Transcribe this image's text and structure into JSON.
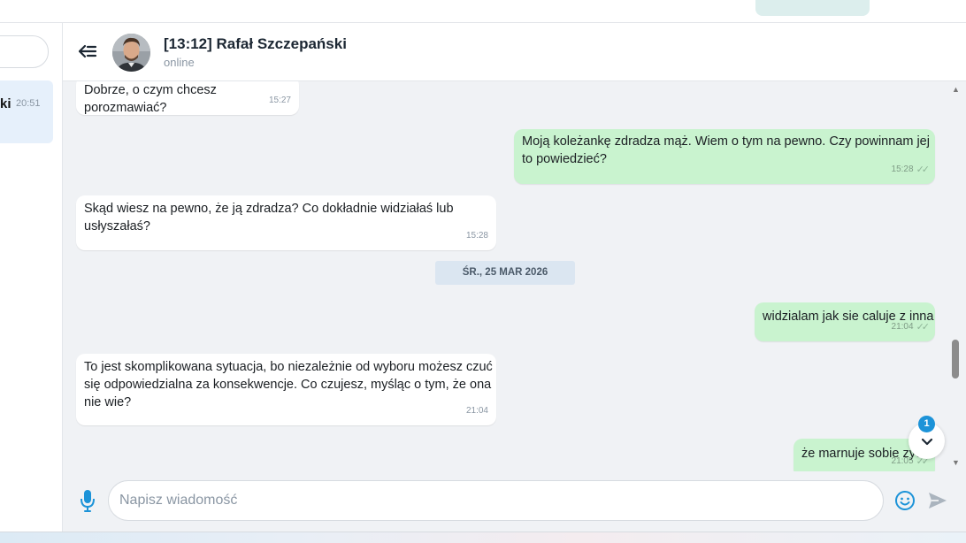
{
  "top": {
    "ghost_text": "p                                                (                                   )  "
  },
  "sidebar": {
    "chat_item": {
      "name_fragment": "ki",
      "time": "20:51"
    }
  },
  "header": {
    "back_icon": "back-arrow-icon",
    "title": "[13:12] Rafał Szczepański",
    "status": "online"
  },
  "messages": [
    {
      "dir": "in",
      "text": "Dobrze, o czym chcesz porozmawiać?",
      "time": "15:27"
    },
    {
      "dir": "out",
      "text": "Moją koleżankę zdradza mąż. Wiem o tym na pewno. Czy powinnam jej\nto powiedzieć?",
      "time": "15:28"
    },
    {
      "dir": "in",
      "text": "Skąd wiesz na pewno, że ją zdradza? Co dokładnie widziałaś lub\nusłyszałaś?",
      "time": "15:28"
    },
    {
      "dir": "out",
      "text": "widzialam jak sie caluje z inna",
      "time": "21:04"
    },
    {
      "dir": "in",
      "text": "To jest skomplikowana sytuacja, bo niezależnie od wyboru możesz czuć\nsię odpowiedzialna za konsekwencje. Co czujesz, myśląc o tym, że ona\nnie wie?",
      "time": "21:04"
    },
    {
      "dir": "out",
      "text": "że marnuje sobie zyc",
      "time": "21:05"
    }
  ],
  "date_separator": "ŚR., 25 MAR 2026",
  "jump": {
    "unread_count": "1"
  },
  "composer": {
    "placeholder": "Napisz wiadomość",
    "value": ""
  },
  "colors": {
    "outgoing_bubble": "#c9f3cf",
    "incoming_bubble": "#ffffff",
    "accent": "#1c93d8",
    "background": "#f0f2f5"
  }
}
